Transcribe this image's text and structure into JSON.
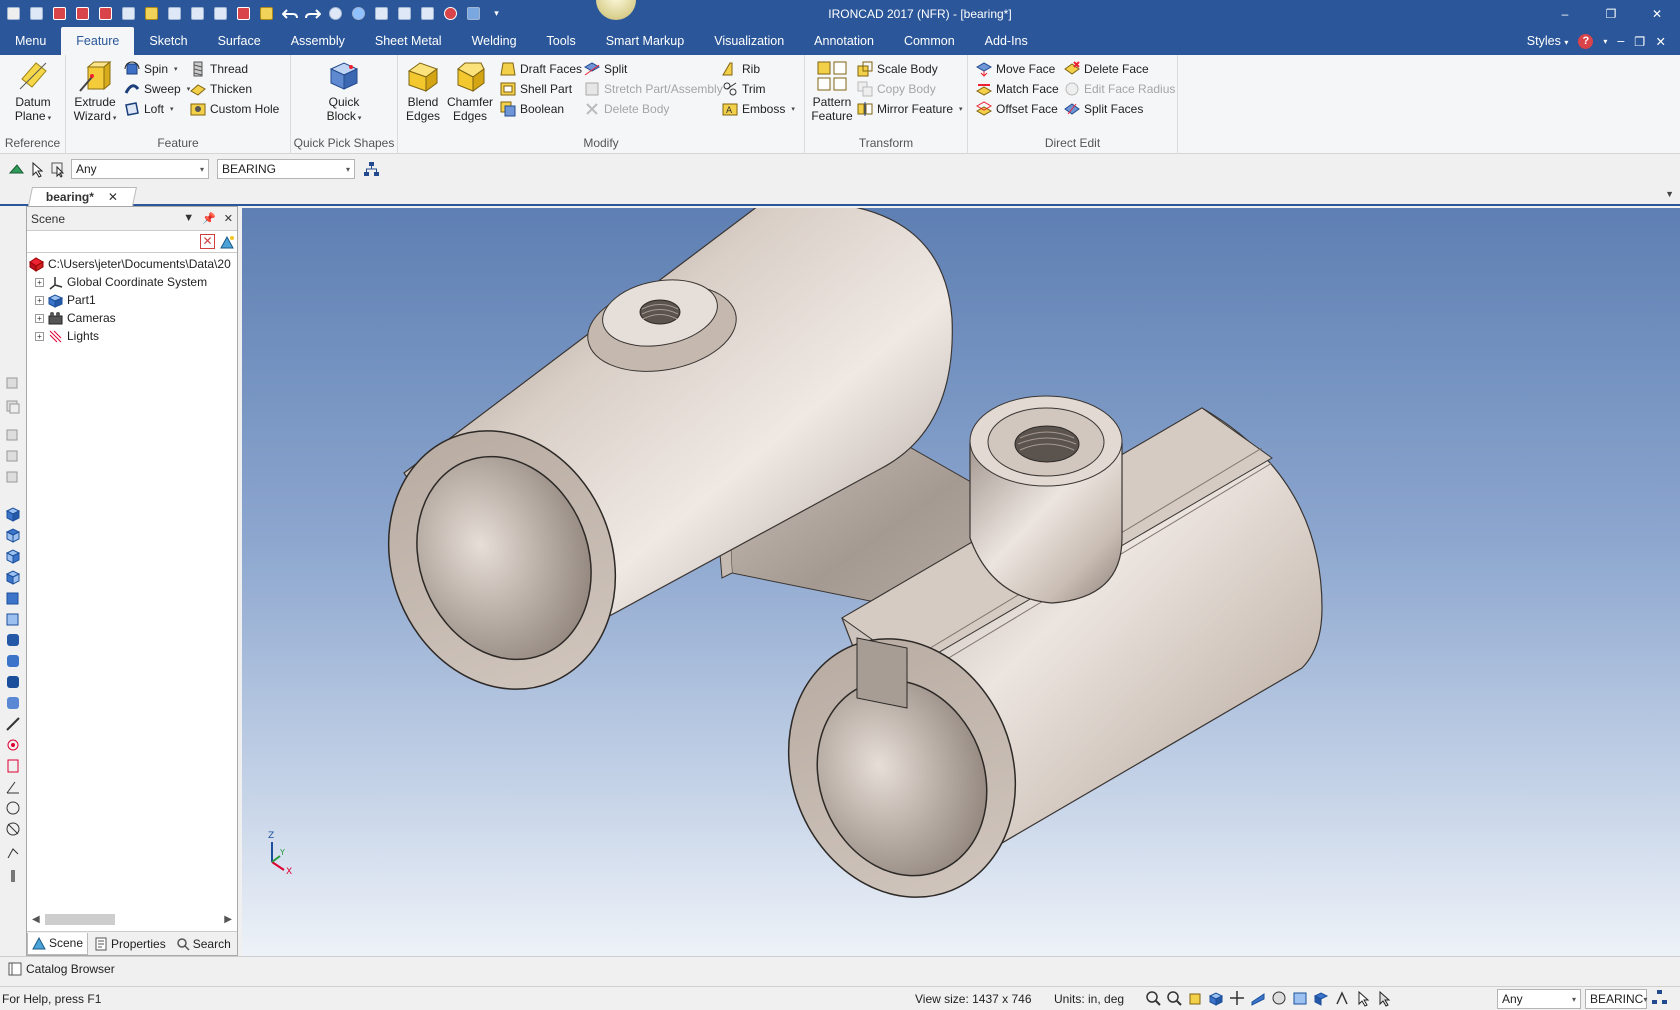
{
  "window": {
    "title": "IRONCAD 2017 (NFR) - [bearing*]",
    "controls": [
      "–",
      "❐",
      "✕"
    ]
  },
  "menu": {
    "tabs": [
      "Menu",
      "Feature",
      "Sketch",
      "Surface",
      "Assembly",
      "Sheet Metal",
      "Welding",
      "Tools",
      "Smart Markup",
      "Visualization",
      "Annotation",
      "Common",
      "Add-Ins"
    ],
    "active": "Feature",
    "styles_label": "Styles",
    "mdi_controls": [
      "–",
      "❐",
      "✕"
    ]
  },
  "ribbon": {
    "reference": {
      "label": "Reference",
      "datum_plane": [
        "Datum",
        "Plane"
      ]
    },
    "feature": {
      "label": "Feature",
      "extrude_wizard": [
        "Extrude",
        "Wizard"
      ],
      "spin": "Spin",
      "sweep": "Sweep",
      "loft": "Loft",
      "thread": "Thread",
      "thicken": "Thicken",
      "custom_hole": "Custom Hole"
    },
    "quick_pick": {
      "label": "Quick Pick Shapes",
      "quick_block": [
        "Quick",
        "Block"
      ]
    },
    "modify": {
      "label": "Modify",
      "blend_edges": [
        "Blend",
        "Edges"
      ],
      "chamfer_edges": [
        "Chamfer",
        "Edges"
      ],
      "draft_faces": "Draft Faces",
      "shell_part": "Shell Part",
      "boolean": "Boolean",
      "split": "Split",
      "stretch_part": "Stretch Part/Assembly",
      "delete_body": "Delete Body",
      "rib": "Rib",
      "trim": "Trim",
      "emboss": "Emboss"
    },
    "transform": {
      "label": "Transform",
      "pattern_feature": [
        "Pattern",
        "Feature"
      ],
      "scale_body": "Scale Body",
      "copy_body": "Copy Body",
      "mirror_feature": "Mirror Feature"
    },
    "direct_edit": {
      "label": "Direct Edit",
      "move_face": "Move Face",
      "match_face": "Match Face",
      "offset_face": "Offset Face",
      "delete_face": "Delete Face",
      "edit_face_radius": "Edit Face Radius",
      "split_faces": "Split Faces"
    }
  },
  "selection_bar": {
    "filter": "Any",
    "part": "BEARING"
  },
  "document": {
    "tab": "bearing*"
  },
  "scene": {
    "title": "Scene",
    "tree": [
      {
        "label": "C:\\Users\\jeter\\Documents\\Data\\20",
        "icon": "scene-root-icon"
      },
      {
        "label": "Global Coordinate System",
        "icon": "axes-icon"
      },
      {
        "label": "Part1",
        "icon": "part-icon"
      },
      {
        "label": "Cameras",
        "icon": "camera-icon"
      },
      {
        "label": "Lights",
        "icon": "light-icon"
      }
    ],
    "tabs": [
      "Scene",
      "Properties",
      "Search"
    ]
  },
  "catalog": {
    "label": "Catalog Browser"
  },
  "status": {
    "help": "For Help, press F1",
    "view_size": "View size: 1437 x  746",
    "units": "Units: in, deg",
    "filter": "Any",
    "part": "BEARINC"
  },
  "triad": {
    "z": "Z",
    "y": "Y",
    "x": "X"
  },
  "colors": {
    "title_blue": "#2b579a",
    "ribbon_bg": "#f5f6f7",
    "part_color": "#c8bcb2"
  }
}
